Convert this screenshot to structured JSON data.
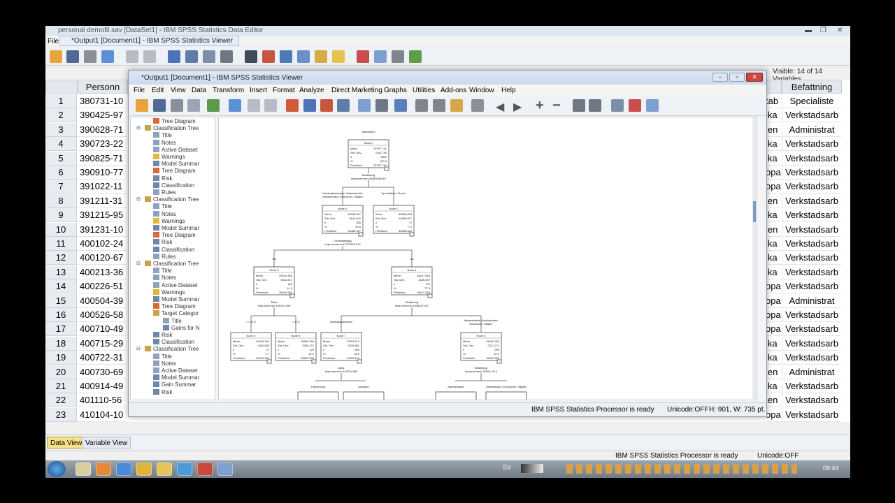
{
  "back_window": {
    "title": "personal demofil.sav [DataSet1] - IBM SPSS Statistics Data Editor",
    "file_menu": "File",
    "viewer_tab": "*Output1 [Document1] - IBM SPSS Statistics Viewer",
    "visible_vars": "Visible: 14 of 14 Variables",
    "col_personnr": "Personn",
    "col_befattning": "Befattning",
    "rows": [
      {
        "n": "1",
        "id": "380731-10",
        "r1": "tab",
        "r2": "Specialiste"
      },
      {
        "n": "2",
        "id": "390425-97",
        "r1": "ika",
        "r2": "Verkstadsarb"
      },
      {
        "n": "3",
        "id": "390628-71",
        "r1": "ien",
        "r2": "Administrat"
      },
      {
        "n": "4",
        "id": "390723-22",
        "r1": "ika",
        "r2": "Verkstadsarb"
      },
      {
        "n": "5",
        "id": "390825-71",
        "r1": "ika",
        "r2": "Verkstadsarb"
      },
      {
        "n": "6",
        "id": "390910-77",
        "r1": "opa",
        "r2": "Verkstadsarb"
      },
      {
        "n": "7",
        "id": "391022-11",
        "r1": "opa",
        "r2": "Verkstadsarb"
      },
      {
        "n": "8",
        "id": "391211-31",
        "r1": "ien",
        "r2": "Verkstadsarb"
      },
      {
        "n": "9",
        "id": "391215-95",
        "r1": "ika",
        "r2": "Verkstadsarb"
      },
      {
        "n": "10",
        "id": "391231-10",
        "r1": "ien",
        "r2": "Verkstadsarb"
      },
      {
        "n": "11",
        "id": "400102-24",
        "r1": "ika",
        "r2": "Verkstadsarb"
      },
      {
        "n": "12",
        "id": "400120-67",
        "r1": "ika",
        "r2": "Verkstadsarb"
      },
      {
        "n": "13",
        "id": "400213-36",
        "r1": "ika",
        "r2": "Verkstadsarb"
      },
      {
        "n": "14",
        "id": "400226-51",
        "r1": "opa",
        "r2": "Verkstadsarb"
      },
      {
        "n": "15",
        "id": "400504-39",
        "r1": "opa",
        "r2": "Administrat"
      },
      {
        "n": "16",
        "id": "400526-58",
        "r1": "opa",
        "r2": "Verkstadsarb"
      },
      {
        "n": "17",
        "id": "400710-49",
        "r1": "opa",
        "r2": "Verkstadsarb"
      },
      {
        "n": "18",
        "id": "400715-29",
        "r1": "ika",
        "r2": "Verkstadsarb"
      },
      {
        "n": "19",
        "id": "400722-31",
        "r1": "ika",
        "r2": "Verkstadsarb"
      },
      {
        "n": "20",
        "id": "400730-69",
        "r1": "ien",
        "r2": "Administrat"
      },
      {
        "n": "21",
        "id": "400914-49",
        "r1": "ika",
        "r2": "Verkstadsarb"
      },
      {
        "n": "22",
        "id": "401110-56",
        "r1": "ien",
        "r2": "Verkstadsarb"
      },
      {
        "n": "23",
        "id": "410104-10",
        "r1": "opa",
        "r2": "Verkstadsarb"
      }
    ],
    "data_view_tab": "Data View",
    "variable_view_tab": "Variable View",
    "status": "IBM SPSS Statistics Processor is ready",
    "unicode": "Unicode:OFF",
    "language": "SV",
    "clock": "09:44"
  },
  "viewer": {
    "title": "*Output1 [Document1] - IBM SPSS Statistics Viewer",
    "menu": [
      "File",
      "Edit",
      "View",
      "Data",
      "Transform",
      "Insert",
      "Format",
      "Analyze",
      "Direct Marketing",
      "Graphs",
      "Utilities",
      "Add-ons",
      "Window",
      "Help"
    ],
    "outline": [
      {
        "level": 2,
        "label": "Tree Diagram",
        "icon": "chart"
      },
      {
        "level": 1,
        "label": "Classification Tree",
        "icon": "book"
      },
      {
        "level": 2,
        "label": "Title",
        "icon": "doc"
      },
      {
        "level": 2,
        "label": "Notes",
        "icon": "doc"
      },
      {
        "level": 2,
        "label": "Active Dataset",
        "icon": "doc"
      },
      {
        "level": 2,
        "label": "Warnings",
        "icon": "warn"
      },
      {
        "level": 2,
        "label": "Model Summar",
        "icon": "table"
      },
      {
        "level": 2,
        "label": "Tree Diagram",
        "icon": "chart"
      },
      {
        "level": 2,
        "label": "Risk",
        "icon": "table"
      },
      {
        "level": 2,
        "label": "Classification",
        "icon": "table"
      },
      {
        "level": 2,
        "label": "Rules",
        "icon": "doc"
      },
      {
        "level": 1,
        "label": "Classification Tree",
        "icon": "book"
      },
      {
        "level": 2,
        "label": "Title",
        "icon": "doc"
      },
      {
        "level": 2,
        "label": "Notes",
        "icon": "doc"
      },
      {
        "level": 2,
        "label": "Warnings",
        "icon": "warn"
      },
      {
        "level": 2,
        "label": "Model Summar",
        "icon": "table"
      },
      {
        "level": 2,
        "label": "Tree Diagram",
        "icon": "chart"
      },
      {
        "level": 2,
        "label": "Risk",
        "icon": "table"
      },
      {
        "level": 2,
        "label": "Classification",
        "icon": "table"
      },
      {
        "level": 2,
        "label": "Rules",
        "icon": "doc"
      },
      {
        "level": 1,
        "label": "Classification Tree",
        "icon": "book"
      },
      {
        "level": 2,
        "label": "Title",
        "icon": "doc"
      },
      {
        "level": 2,
        "label": "Notes",
        "icon": "doc"
      },
      {
        "level": 2,
        "label": "Active Dataset",
        "icon": "doc"
      },
      {
        "level": 2,
        "label": "Warnings",
        "icon": "warn"
      },
      {
        "level": 2,
        "label": "Model Summar",
        "icon": "table"
      },
      {
        "level": 2,
        "label": "Tree Diagram",
        "icon": "chart"
      },
      {
        "level": 2,
        "label": "Target Categor",
        "icon": "book"
      },
      {
        "level": 3,
        "label": "Title",
        "icon": "doc"
      },
      {
        "level": 3,
        "label": "Gains for N",
        "icon": "table"
      },
      {
        "level": 2,
        "label": "Risk",
        "icon": "table"
      },
      {
        "level": 2,
        "label": "Classification",
        "icon": "table"
      },
      {
        "level": 1,
        "label": "Classification Tree",
        "icon": "book"
      },
      {
        "level": 2,
        "label": "Title",
        "icon": "doc"
      },
      {
        "level": 2,
        "label": "Notes",
        "icon": "doc"
      },
      {
        "level": 2,
        "label": "Active Dataset",
        "icon": "doc"
      },
      {
        "level": 2,
        "label": "Model Summar",
        "icon": "table"
      },
      {
        "level": 2,
        "label": "Gain Summar",
        "icon": "table"
      },
      {
        "level": 2,
        "label": "Risk",
        "icon": "table"
      }
    ],
    "tree": {
      "root_label": "Månadslön",
      "split1": {
        "var": "Befattning",
        "improvement": "Improvement=2608304836+"
      },
      "branch_left_1": "Verkstadsarbetare; Administratör; Arbetsledare; Ekonomer; Säljare",
      "branch_right_1": "Specialister; Chefer",
      "split2": {
        "var": "Övertidstillägg",
        "improvement": "Improvement=67272964.019"
      },
      "branch_yes": "Yes",
      "branch_no": "No",
      "split3a": {
        "var": "Ålder",
        "improvement": "Improvement=13913x.408"
      },
      "split3b": {
        "var": "Befattning",
        "improvement": "Improvement=100816T.337"
      },
      "branch_age_low": "<= 37.5",
      "branch_age_high": "> 37.5",
      "branch_verk": "Verkstadsarbetare",
      "branch_admin": "Administratör; Arbetsledare; Ekonomer; Säljare",
      "split4a": {
        "var": "Avtal",
        "improvement": "Improvement=19223x.583"
      },
      "split4b": {
        "var": "Befattning",
        "improvement": "Improvement=3256x.1114"
      },
      "branch_tjm": "Tjänsteman",
      "branch_arb": "Arbetare",
      "branch_adm2": "Administratör",
      "branch_arbled": "Arbetsledare; Ekonomer; Säljare",
      "nodes": [
        {
          "id": "n0",
          "title": "Node 0",
          "rows": [
            [
              "Mean",
              "20797.741"
            ],
            [
              "Std. Dev.",
              "7042.745"
            ],
            [
              "n",
              "1000"
            ],
            [
              "%",
              "100.0"
            ],
            [
              "Predicted",
              "20797.741"
            ]
          ]
        },
        {
          "id": "n1",
          "title": "Node 1",
          "rows": [
            [
              "Mean",
              "19285.517"
            ],
            [
              "Std. Dev.",
              "3611.642"
            ],
            [
              "n",
              "928"
            ],
            [
              "%",
              "92.8"
            ],
            [
              "Predicted",
              "19285.517"
            ]
          ]
        },
        {
          "id": "n2",
          "title": "Node 2",
          "rows": [
            [
              "Mean",
              "40088.825"
            ],
            [
              "Std. Dev.",
              "14986.827"
            ],
            [
              "n",
              "72"
            ],
            [
              "%",
              "7.2"
            ],
            [
              "Predicted",
              "40088.825"
            ]
          ]
        },
        {
          "id": "n3",
          "title": "Node 3",
          "rows": [
            [
              "Mean",
              "25444.362"
            ],
            [
              "Std. Dev.",
              "3332.817"
            ],
            [
              "n",
              "149"
            ],
            [
              "%",
              "14.9"
            ],
            [
              "Predicted",
              "25444.362"
            ]
          ]
        },
        {
          "id": "n4",
          "title": "Node 4",
          "rows": [
            [
              "Mean",
              "18107.518"
            ],
            [
              "Std. Dev.",
              "2185.257"
            ],
            [
              "n",
              "779"
            ],
            [
              "%",
              "77.9"
            ],
            [
              "Predicted",
              "18107.518"
            ]
          ]
        },
        {
          "id": "n5",
          "title": "Node 5",
          "rows": [
            [
              "Mean",
              "22090.259"
            ],
            [
              "Std. Dev.",
              "2400.805"
            ],
            [
              "n",
              "27"
            ],
            [
              "%",
              "2.7"
            ],
            [
              "Predicted",
              "22090.259"
            ]
          ]
        },
        {
          "id": "n6",
          "title": "Node 6",
          "rows": [
            [
              "Mean",
              "25899.359"
            ],
            [
              "Std. Dev.",
              "3330.272"
            ],
            [
              "n",
              "122"
            ],
            [
              "%",
              "12.2"
            ],
            [
              "Predicted",
              "25899.359"
            ]
          ]
        },
        {
          "id": "n7",
          "title": "Node 7",
          "rows": [
            [
              "Mean",
              "17003.110"
            ],
            [
              "Std. Dev.",
              "1034.581"
            ],
            [
              "n",
              "489"
            ],
            [
              "%",
              "48.9"
            ],
            [
              "Predicted",
              "17003.110"
            ]
          ]
        },
        {
          "id": "n8",
          "title": "Node 8",
          "rows": [
            [
              "Mean",
              "19602.334"
            ],
            [
              "Std. Dev.",
              "2371.272"
            ],
            [
              "n",
              "290"
            ],
            [
              "%",
              "29.0"
            ],
            [
              "Predicted",
              "19602.334"
            ]
          ]
        }
      ]
    },
    "status": "IBM SPSS Statistics Processor is ready",
    "unicode": "Unicode:OFF",
    "dimensions": "H: 901, W: 735 pt."
  }
}
